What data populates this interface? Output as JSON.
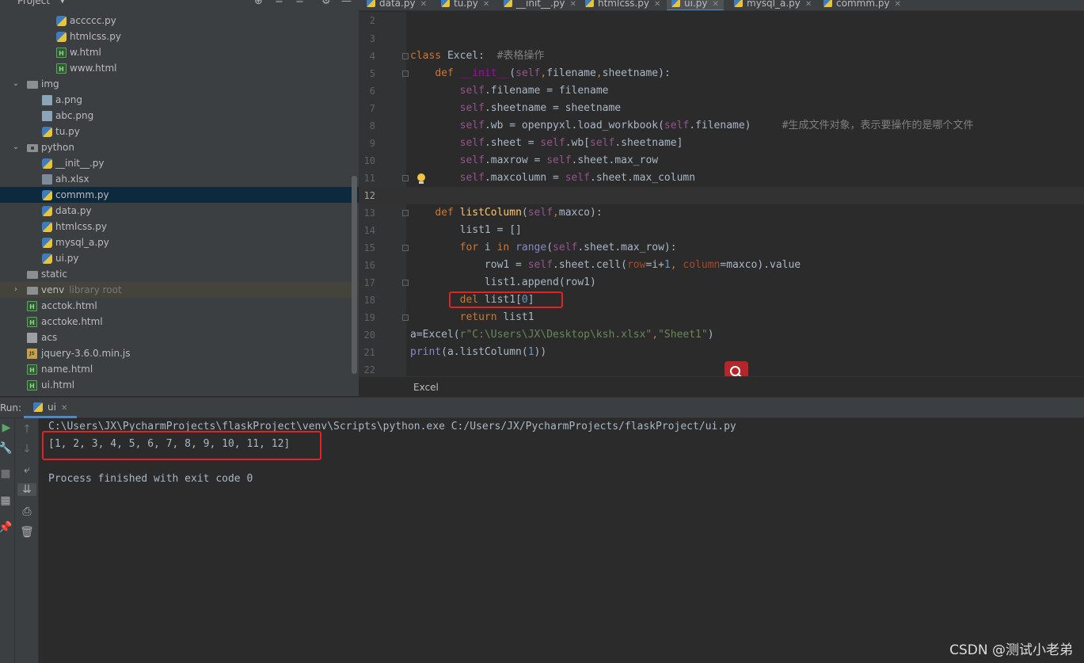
{
  "project": {
    "title": "Project",
    "tree": [
      {
        "label": "accccc.py",
        "icon": "python-file-icon"
      },
      {
        "label": "htmlcss.py",
        "icon": "python-file-icon"
      },
      {
        "label": "w.html",
        "icon": "html-file-icon"
      },
      {
        "label": "www.html",
        "icon": "html-file-icon"
      },
      {
        "label": "img",
        "icon": "folder-icon",
        "expanded": true
      },
      {
        "label": "a.png",
        "icon": "image-file-icon"
      },
      {
        "label": "abc.png",
        "icon": "image-file-icon"
      },
      {
        "label": "tu.py",
        "icon": "python-file-icon"
      },
      {
        "label": "python",
        "icon": "package-folder-icon",
        "expanded": true
      },
      {
        "label": "__init__.py",
        "icon": "python-file-icon"
      },
      {
        "label": "ah.xlsx",
        "icon": "excel-file-icon"
      },
      {
        "label": "commm.py",
        "icon": "python-file-icon",
        "selected": true
      },
      {
        "label": "data.py",
        "icon": "python-file-icon"
      },
      {
        "label": "htmlcss.py",
        "icon": "python-file-icon"
      },
      {
        "label": "mysql_a.py",
        "icon": "python-file-icon"
      },
      {
        "label": "ui.py",
        "icon": "python-file-icon"
      },
      {
        "label": "static",
        "icon": "folder-icon"
      },
      {
        "label": "venv",
        "hint": "library root",
        "icon": "folder-icon",
        "expanded": false
      },
      {
        "label": "acctok.html",
        "icon": "html-file-icon"
      },
      {
        "label": "acctoke.html",
        "icon": "html-file-icon"
      },
      {
        "label": "acs",
        "icon": "text-file-icon"
      },
      {
        "label": "jquery-3.6.0.min.js",
        "icon": "js-file-icon"
      },
      {
        "label": "name.html",
        "icon": "html-file-icon"
      },
      {
        "label": "ui.html",
        "icon": "html-file-icon"
      }
    ]
  },
  "editor": {
    "tabs": [
      {
        "label": "data.py"
      },
      {
        "label": "tu.py"
      },
      {
        "label": "__init__.py"
      },
      {
        "label": "htmlcss.py"
      },
      {
        "label": "ui.py",
        "active": true
      },
      {
        "label": "mysql_a.py"
      },
      {
        "label": "commm.py"
      }
    ],
    "line_numbers": [
      "2",
      "3",
      "4",
      "5",
      "6",
      "7",
      "8",
      "9",
      "10",
      "11",
      "12",
      "13",
      "14",
      "15",
      "16",
      "17",
      "18",
      "19",
      "20",
      "21",
      "22"
    ],
    "current_line": "12",
    "breadcrumb": "Excel"
  },
  "run": {
    "label": "Run:",
    "tab": "ui",
    "lines": [
      "C:\\Users\\JX\\PycharmProjects\\flaskProject\\venv\\Scripts\\python.exe C:/Users/JX/PycharmProjects/flaskProject/ui.py",
      "[1, 2, 3, 4, 5, 6, 7, 8, 9, 10, 11, 12]",
      "",
      "Process finished with exit code 0"
    ]
  },
  "watermark": "CSDN @测试小老弟",
  "colors": {
    "highlight_box": "#e02424",
    "search_button": "#b3262a",
    "selection": "#0d293e"
  }
}
